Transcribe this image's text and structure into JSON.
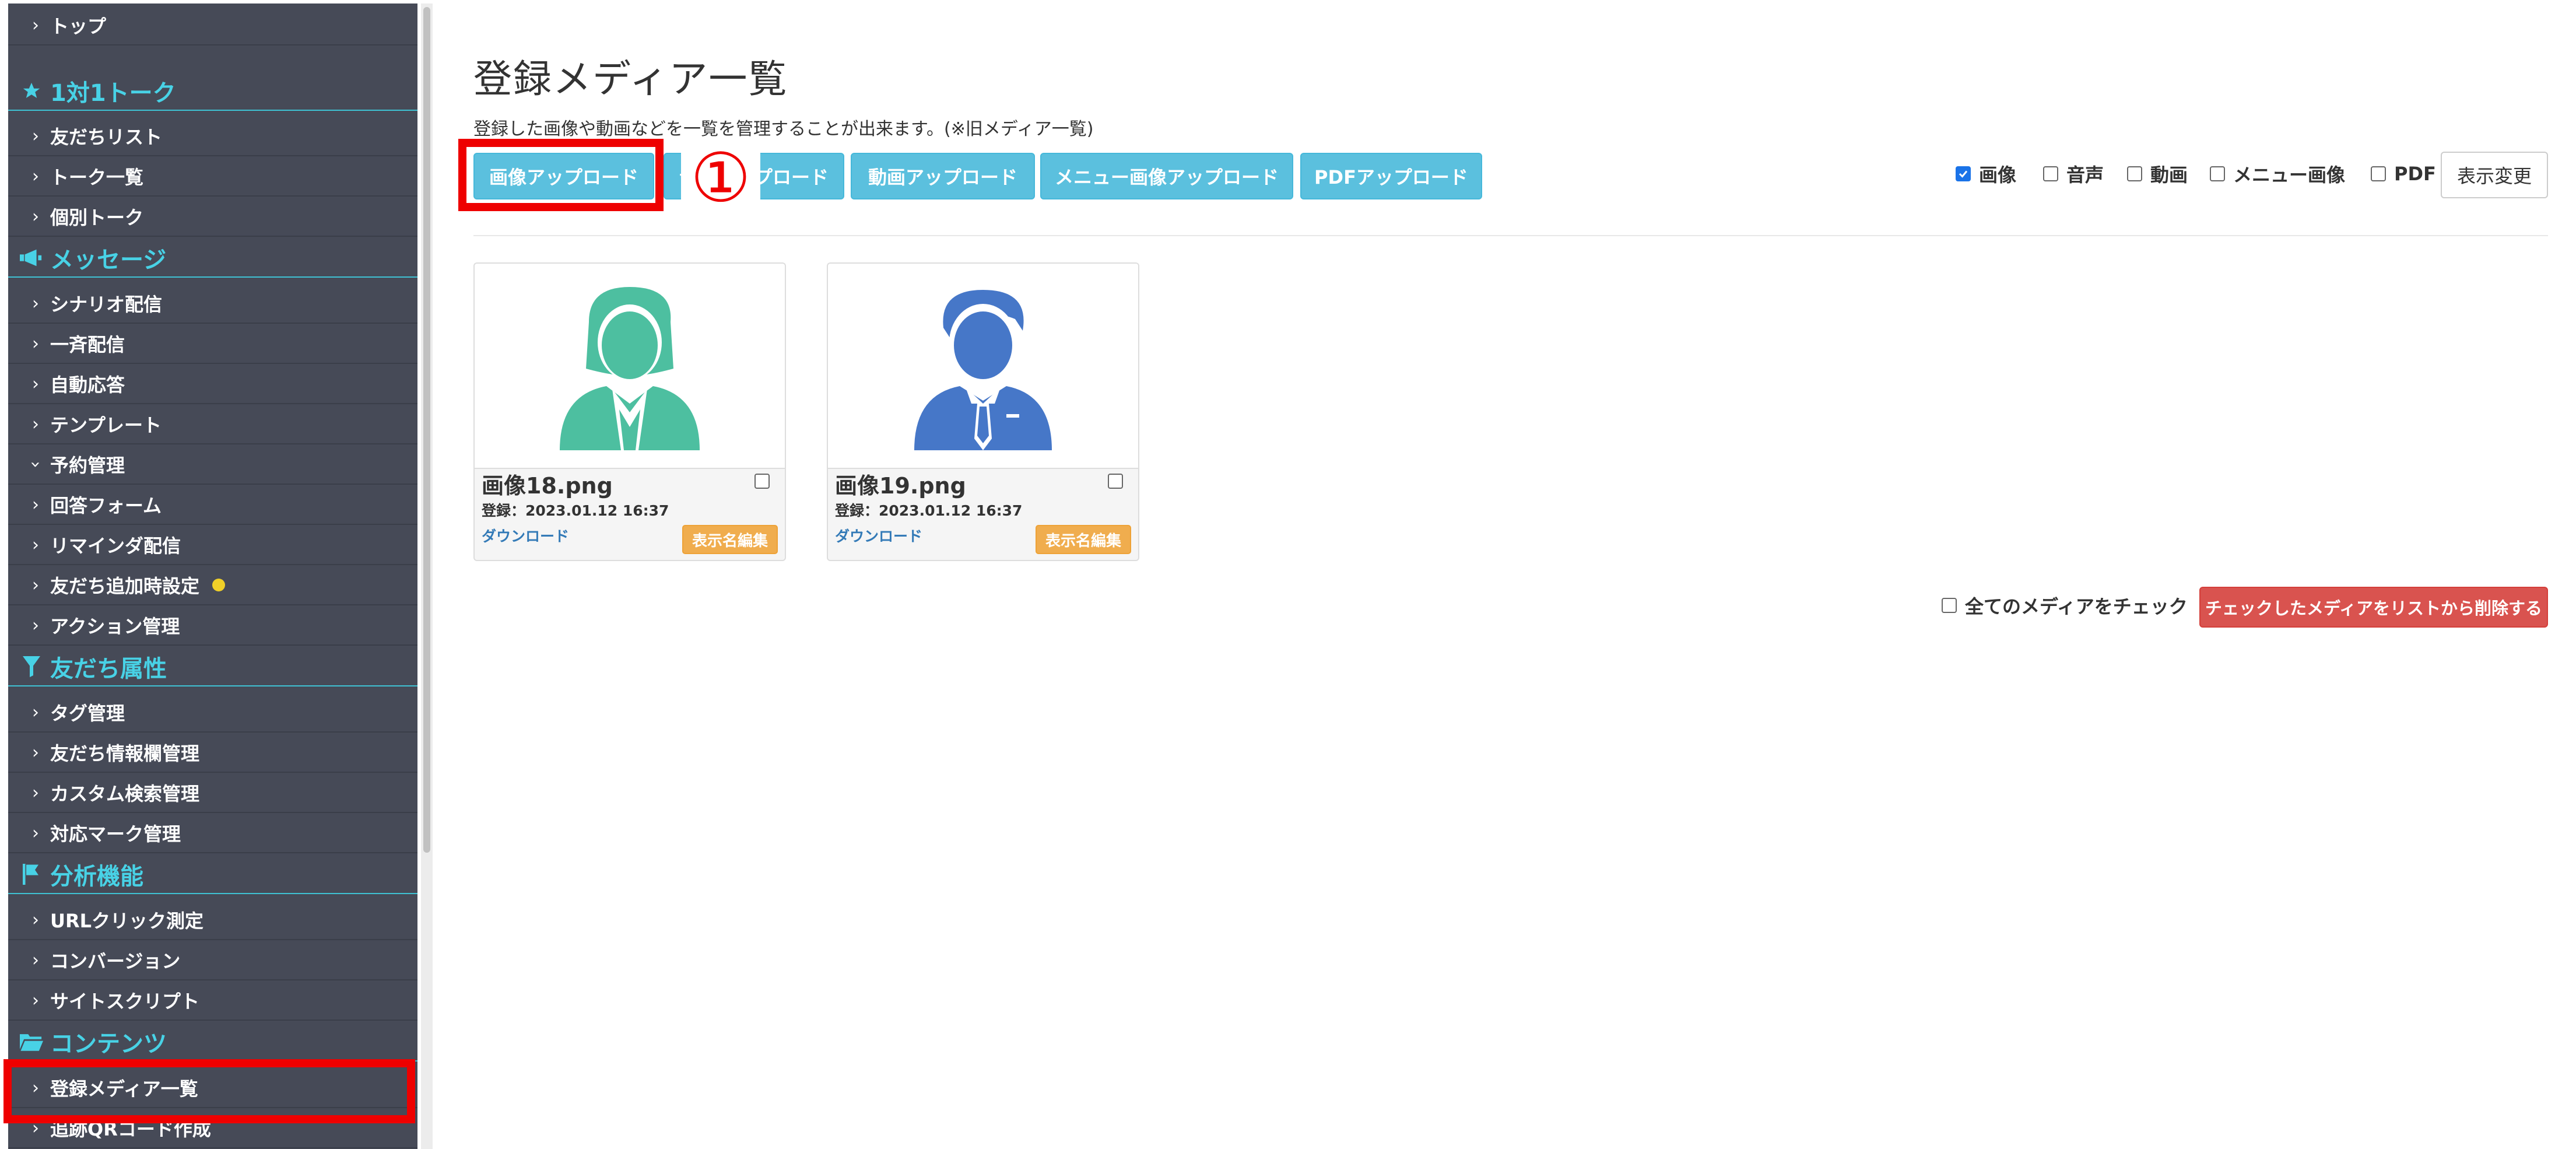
{
  "sidebar": {
    "items": [
      {
        "type": "item",
        "label": "トップ",
        "chevron": "right"
      },
      {
        "type": "section",
        "label": "1対1トーク",
        "icon": "star-icon"
      },
      {
        "type": "item",
        "label": "友だちリスト",
        "chevron": "right"
      },
      {
        "type": "item",
        "label": "トーク一覧",
        "chevron": "right"
      },
      {
        "type": "item",
        "label": "個別トーク",
        "chevron": "right"
      },
      {
        "type": "section",
        "label": "メッセージ",
        "icon": "megaphone-icon"
      },
      {
        "type": "item",
        "label": "シナリオ配信",
        "chevron": "right"
      },
      {
        "type": "item",
        "label": "一斉配信",
        "chevron": "right"
      },
      {
        "type": "item",
        "label": "自動応答",
        "chevron": "right"
      },
      {
        "type": "item",
        "label": "テンプレート",
        "chevron": "right"
      },
      {
        "type": "item",
        "label": "予約管理",
        "chevron": "down"
      },
      {
        "type": "item",
        "label": "回答フォーム",
        "chevron": "right"
      },
      {
        "type": "item",
        "label": "リマインダ配信",
        "chevron": "right"
      },
      {
        "type": "item",
        "label": "友だち追加時設定",
        "chevron": "right",
        "dot": true
      },
      {
        "type": "item",
        "label": "アクション管理",
        "chevron": "right"
      },
      {
        "type": "section",
        "label": "友だち属性",
        "icon": "filter-icon"
      },
      {
        "type": "item",
        "label": "タグ管理",
        "chevron": "right"
      },
      {
        "type": "item",
        "label": "友だち情報欄管理",
        "chevron": "right"
      },
      {
        "type": "item",
        "label": "カスタム検索管理",
        "chevron": "right"
      },
      {
        "type": "item",
        "label": "対応マーク管理",
        "chevron": "right"
      },
      {
        "type": "section",
        "label": "分析機能",
        "icon": "flag-icon"
      },
      {
        "type": "item",
        "label": "URLクリック測定",
        "chevron": "right"
      },
      {
        "type": "item",
        "label": "コンバージョン",
        "chevron": "right"
      },
      {
        "type": "item",
        "label": "サイトスクリプト",
        "chevron": "right"
      },
      {
        "type": "section",
        "label": "コンテンツ",
        "icon": "folder-icon"
      },
      {
        "type": "item",
        "label": "登録メディア一覧",
        "chevron": "right",
        "active": true
      },
      {
        "type": "item",
        "label": "追跡QRコード作成",
        "chevron": "right"
      }
    ]
  },
  "page": {
    "title": "登録メディア一覧",
    "description": "登録した画像や動画などを一覧を管理することが出来ます。(※旧メディア一覧)"
  },
  "upload_buttons": [
    "画像アップロード",
    "音声アップロード",
    "動画アップロード",
    "メニュー画像アップロード",
    "PDFアップロード"
  ],
  "annotation": {
    "step_marker": "①"
  },
  "filters": [
    {
      "label": "画像",
      "checked": true
    },
    {
      "label": "音声",
      "checked": false
    },
    {
      "label": "動画",
      "checked": false
    },
    {
      "label": "メニュー画像",
      "checked": false
    },
    {
      "label": "PDF",
      "checked": false
    }
  ],
  "view_change_label": "表示変更",
  "media": [
    {
      "name": "画像18.png",
      "date": "登録：2023.01.12 16:37",
      "download_label": "ダウンロード",
      "edit_label": "表示名編集",
      "avatar": "female-user-icon",
      "color": "#4dbfa0"
    },
    {
      "name": "画像19.png",
      "date": "登録：2023.01.12 16:37",
      "download_label": "ダウンロード",
      "edit_label": "表示名編集",
      "avatar": "male-user-icon",
      "color": "#4677c8"
    }
  ],
  "check_all_label": "全てのメディアをチェック",
  "delete_label": "チェックしたメディアをリストから削除する",
  "colors": {
    "sidebar_bg": "#464a57",
    "section_text": "#48d2e6",
    "upload_btn": "#5bc0de",
    "edit_btn": "#f0ad4e",
    "delete_btn": "#d9534f",
    "highlight": "#ee0000"
  }
}
